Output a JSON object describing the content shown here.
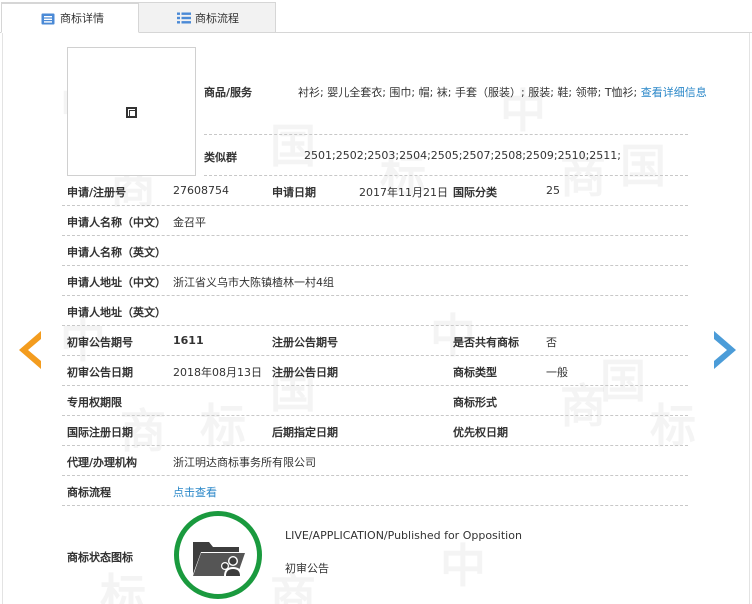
{
  "tabs": [
    {
      "label": "商标详情",
      "icon": "document-icon",
      "active": true
    },
    {
      "label": "商标流程",
      "icon": "list-icon",
      "active": false
    }
  ],
  "watermark": [
    "中",
    "国",
    "商",
    "标"
  ],
  "goods": {
    "label": "商品/服务",
    "value": "衬衫; 婴儿全套衣; 围巾; 帽; 袜; 手套（服装）; 服装; 鞋; 领带; T恤衫;",
    "link": "查看详细信息"
  },
  "similar_group": {
    "label": "类似群",
    "value": "2501;2502;2503;2504;2505;2507;2508;2509;2510;2511;"
  },
  "rows": {
    "reg_no": {
      "label": "申请/注册号",
      "value": "27608754"
    },
    "app_date": {
      "label": "申请日期",
      "value": "2017年11月21日"
    },
    "intl_class": {
      "label": "国际分类",
      "value": "25"
    },
    "applicant_cn": {
      "label": "申请人名称（中文）",
      "value": "金召平"
    },
    "applicant_en": {
      "label": "申请人名称（英文）",
      "value": ""
    },
    "address_cn": {
      "label": "申请人地址（中文）",
      "value": "浙江省义乌市大陈镇楂林一村4组"
    },
    "address_en": {
      "label": "申请人地址（英文）",
      "value": ""
    },
    "prelim_no": {
      "label": "初审公告期号",
      "value": "1611"
    },
    "reg_pub_no": {
      "label": "注册公告期号",
      "value": ""
    },
    "shared": {
      "label": "是否共有商标",
      "value": "否"
    },
    "prelim_date": {
      "label": "初审公告日期",
      "value": "2018年08月13日"
    },
    "reg_pub_date": {
      "label": "注册公告日期",
      "value": ""
    },
    "tm_type": {
      "label": "商标类型",
      "value": "一般"
    },
    "exclusive_term": {
      "label": "专用权期限",
      "value": ""
    },
    "tm_form": {
      "label": "商标形式",
      "value": ""
    },
    "intl_reg_date": {
      "label": "国际注册日期",
      "value": ""
    },
    "later_date": {
      "label": "后期指定日期",
      "value": ""
    },
    "priority_date": {
      "label": "优先权日期",
      "value": ""
    },
    "agent": {
      "label": "代理/办理机构",
      "value": "浙江明达商标事务所有限公司"
    },
    "flow": {
      "label": "商标流程",
      "link": "点击查看"
    },
    "status": {
      "label": "商标状态图标",
      "status_en": "LIVE/APPLICATION/Published for Opposition",
      "status_cn": "初审公告"
    }
  },
  "colors": {
    "link": "#2a87c8",
    "prev_arrow": "#f39c1e",
    "next_arrow": "#4b9cd8",
    "status_ring": "#1a9a3e"
  }
}
